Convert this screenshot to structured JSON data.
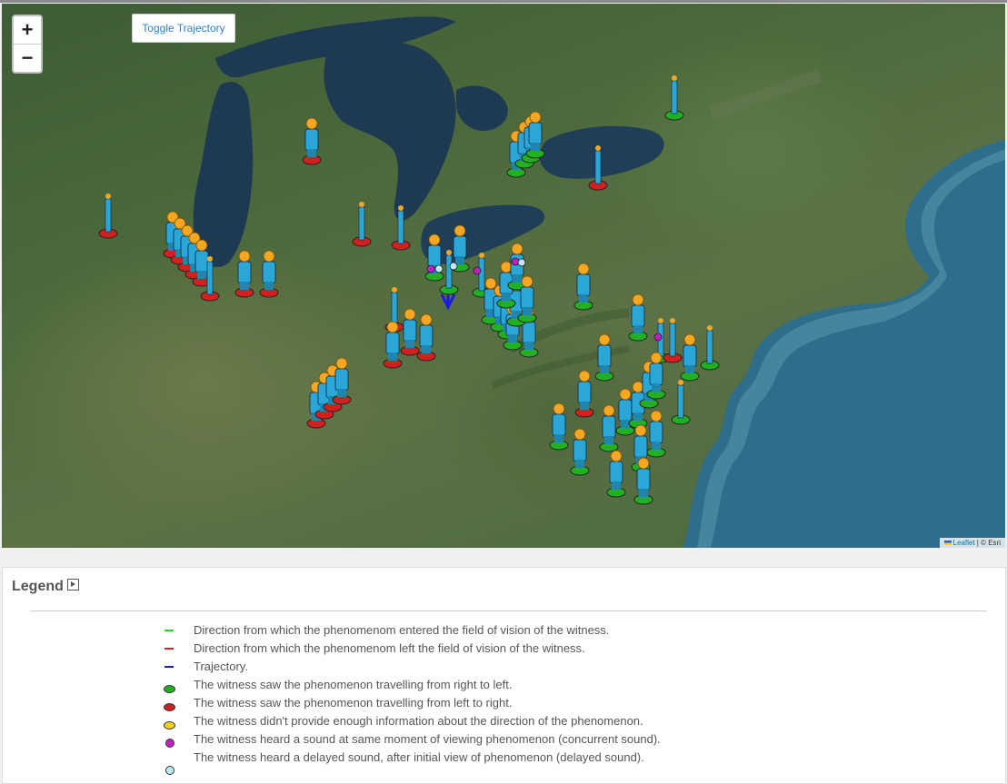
{
  "map": {
    "toggle_label": "Toggle Trajectory",
    "zoom_in": "+",
    "zoom_out": "−",
    "attribution_leaflet": "Leaflet",
    "attribution_rest": " | © Esri"
  },
  "legend": {
    "title": "Legend",
    "items": [
      {
        "symbol": "line",
        "color": "#22dd22",
        "text": "Direction from which the phenomenom entered the field of vision of the witness."
      },
      {
        "symbol": "line",
        "color": "#dd2222",
        "text": "Direction from which the phenomenom left the field of vision of the witness."
      },
      {
        "symbol": "line",
        "color": "#1a1adc",
        "text": "Trajectory."
      },
      {
        "symbol": "pill",
        "color": "#22b022",
        "text": "The witness saw the phenomenon travelling from right to left."
      },
      {
        "symbol": "pill",
        "color": "#d22020",
        "text": "The witness saw the phenomenon travelling from left to right."
      },
      {
        "symbol": "pill",
        "color": "#f2d21c",
        "text": "The witness didn't provide enough information about the direction of the phenomenon."
      },
      {
        "symbol": "dot",
        "color": "#c020c0",
        "text": "The witness heard a sound at same moment of viewing phenomenon (concurrent sound)."
      },
      {
        "symbol": "dot",
        "color": "#bfe8f6",
        "text": "The witness heard a delayed sound, after initial view of phenomenon (delayed sound)."
      }
    ]
  },
  "colors": {
    "person_body": "#2aa7d6",
    "person_head": "#f5a623",
    "base_red": "#d22020",
    "base_green": "#22b022",
    "base_yellow": "#f2d21c",
    "trajectory": "#1a1adc",
    "water": "#1f3e56",
    "ocean": "#2b6e8c"
  }
}
